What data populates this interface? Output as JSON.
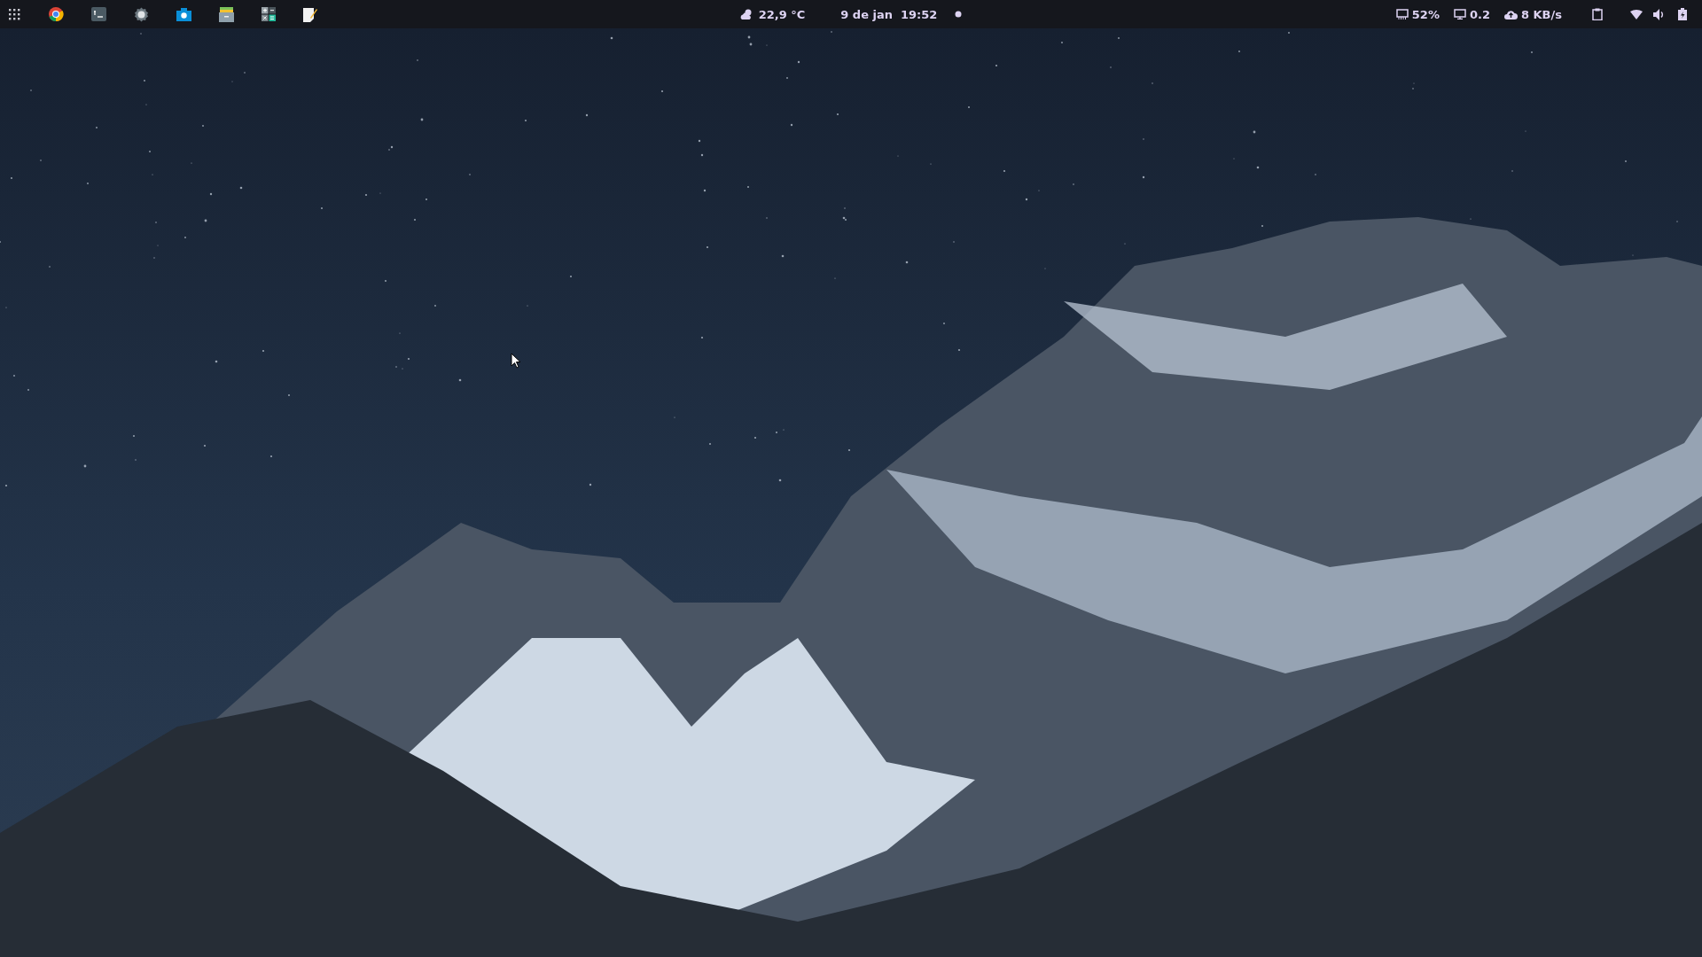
{
  "panel": {
    "weather": {
      "temperature": "22,9 °C"
    },
    "clock": {
      "date": "9 de jan",
      "time": "19:52"
    },
    "indicators": [
      {
        "kind": "cpu",
        "value": "52%"
      },
      {
        "kind": "load",
        "value": "0.2"
      },
      {
        "kind": "network",
        "value": "8 KB/s"
      }
    ]
  }
}
